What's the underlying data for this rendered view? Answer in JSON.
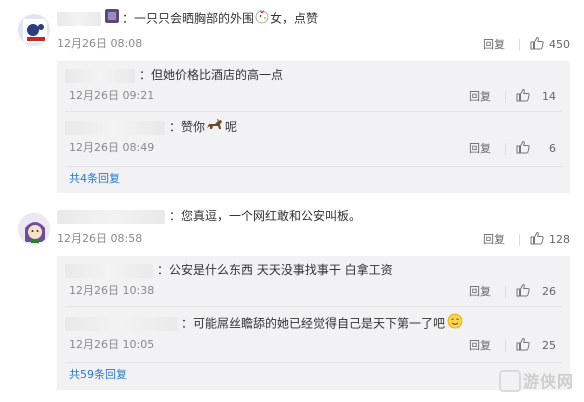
{
  "comments": [
    {
      "text": "：一只只会晒胸部的外围",
      "text_tail": "女，点赞",
      "time": "12月26日 08:08",
      "reply_label": "回复",
      "likes": "450",
      "replies": [
        {
          "text": "：但她价格比酒店的高一点",
          "time": "12月26日 09:21",
          "reply_label": "回复",
          "likes": "14"
        },
        {
          "text": "：赞你",
          "text_tail": "呢",
          "time": "12月26日 08:49",
          "reply_label": "回复",
          "likes": "6"
        }
      ],
      "more_label": "共4条回复"
    },
    {
      "text": "：您真逗，一个网红敢和公安叫板。",
      "time": "12月26日 08:58",
      "reply_label": "回复",
      "likes": "128",
      "replies": [
        {
          "text": "：公安是什么东西 天天没事找事干 白拿工资",
          "time": "12月26日 10:38",
          "reply_label": "回复",
          "likes": "26"
        },
        {
          "text": "：可能屌丝瞻舔的她已经觉得自己是天下第一了吧",
          "time": "12月26日 10:05",
          "reply_label": "回复",
          "likes": "25"
        }
      ],
      "more_label": "共59条回复"
    }
  ],
  "watermark": "游侠网",
  "icons": {
    "like": "thumbs-up-icon",
    "chicken": "chicken-emoji",
    "horse": "horse-emoji",
    "smile": "smile-emoji"
  },
  "colors": {
    "link": "#2c79c6",
    "sub_bg": "#f2f2f5",
    "meta": "#8a8a8a"
  }
}
